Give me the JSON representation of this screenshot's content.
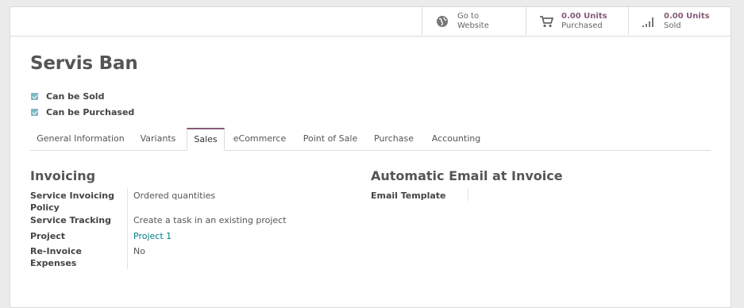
{
  "stat_buttons": {
    "website": {
      "line1": "Go to",
      "line2": "Website",
      "icon": "globe-icon"
    },
    "purchased": {
      "value": "0.00 Units",
      "label": "Purchased",
      "icon": "cart-icon"
    },
    "sold": {
      "value": "0.00 Units",
      "label": "Sold",
      "icon": "bar-chart-icon"
    }
  },
  "product": {
    "name": "Servis Ban",
    "can_be_sold": "Can be Sold",
    "can_be_purchased": "Can be Purchased"
  },
  "tabs": [
    "General Information",
    "Variants",
    "Sales",
    "eCommerce",
    "Point of Sale",
    "Purchase",
    "Accounting"
  ],
  "active_tab": "Sales",
  "invoicing": {
    "title": "Invoicing",
    "service_invoicing_policy_label": "Service Invoicing Policy",
    "service_invoicing_policy_value": "Ordered quantities",
    "service_tracking_label": "Service Tracking",
    "service_tracking_value": "Create a task in an existing project",
    "project_label": "Project",
    "project_value": "Project 1",
    "reinvoice_label": "Re-Invoice Expenses",
    "reinvoice_value": "No"
  },
  "email": {
    "title": "Automatic Email at Invoice",
    "template_label": "Email Template"
  },
  "colors": {
    "accent": "#875a7b",
    "link": "#017e84",
    "checkbox": "#7fb8c4"
  }
}
